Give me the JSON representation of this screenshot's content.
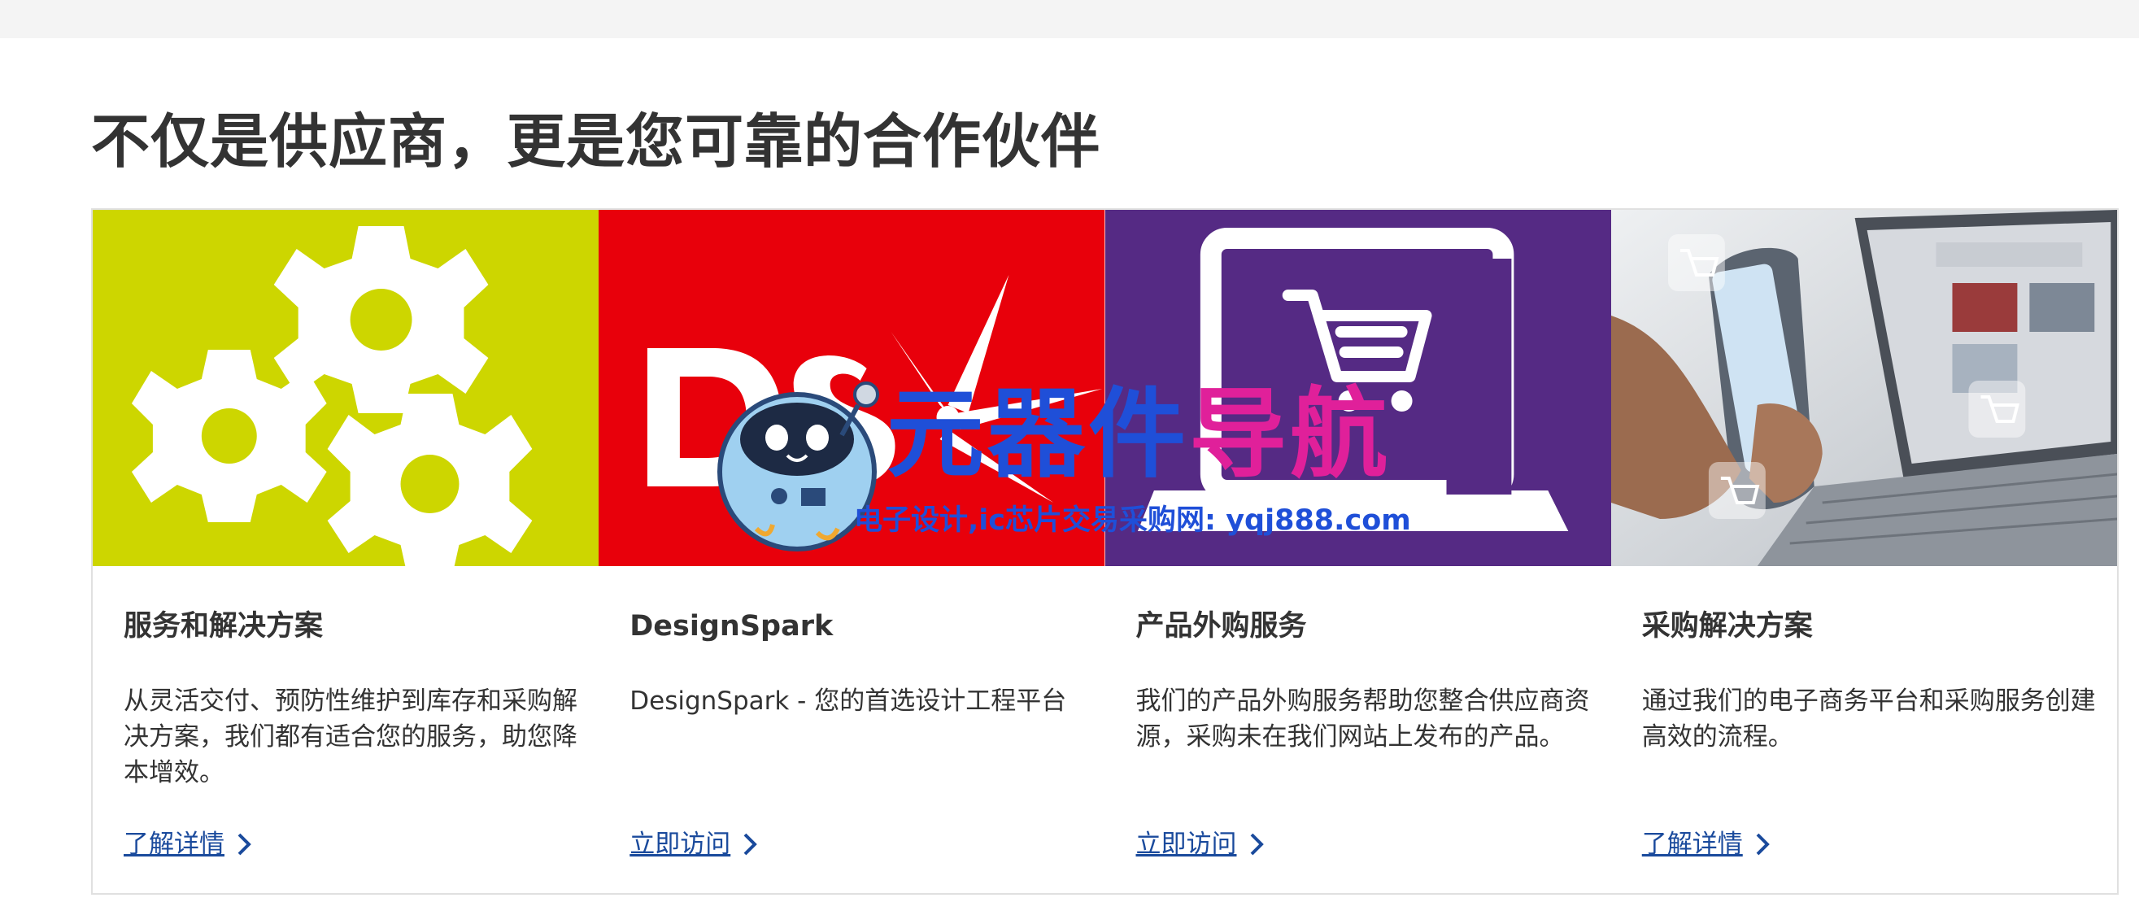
{
  "section": {
    "title": "不仅是供应商，更是您可靠的合作伙伴"
  },
  "cards": [
    {
      "image_icon": "gears-icon",
      "image_bg": "#cdd600",
      "title": "服务和解决方案",
      "description": "从灵活交付、预防性维护到库存和采购解决方案，我们都有适合您的服务，助您降本增效。",
      "link": "了解详情"
    },
    {
      "image_icon": "designspark-logo",
      "image_bg": "#e8000b",
      "title": "DesignSpark",
      "description": "DesignSpark - 您的首选设计工程平台",
      "link": "立即访问"
    },
    {
      "image_icon": "laptop-cart-icon",
      "image_bg": "#552a84",
      "title": "产品外购服务",
      "description": "我们的产品外购服务帮助您整合供应商资源，采购未在我们网站上发布的产品。",
      "link": "立即访问"
    },
    {
      "image_icon": "ecommerce-photo",
      "image_bg": "#dcdfe3",
      "title": "采购解决方案",
      "description": "通过我们的电子商务平台和采购服务创建高效的流程。",
      "link": "了解详情"
    }
  ],
  "watermark": {
    "title_part1": "元器件",
    "title_part2": "导航",
    "subtitle": "电子设计,ic芯片交易采购网: yqj888.com"
  },
  "colors": {
    "link": "#1a4a9c",
    "text": "#333333",
    "watermark_blue": "#1f4fd8",
    "watermark_pink": "#e0209a"
  }
}
